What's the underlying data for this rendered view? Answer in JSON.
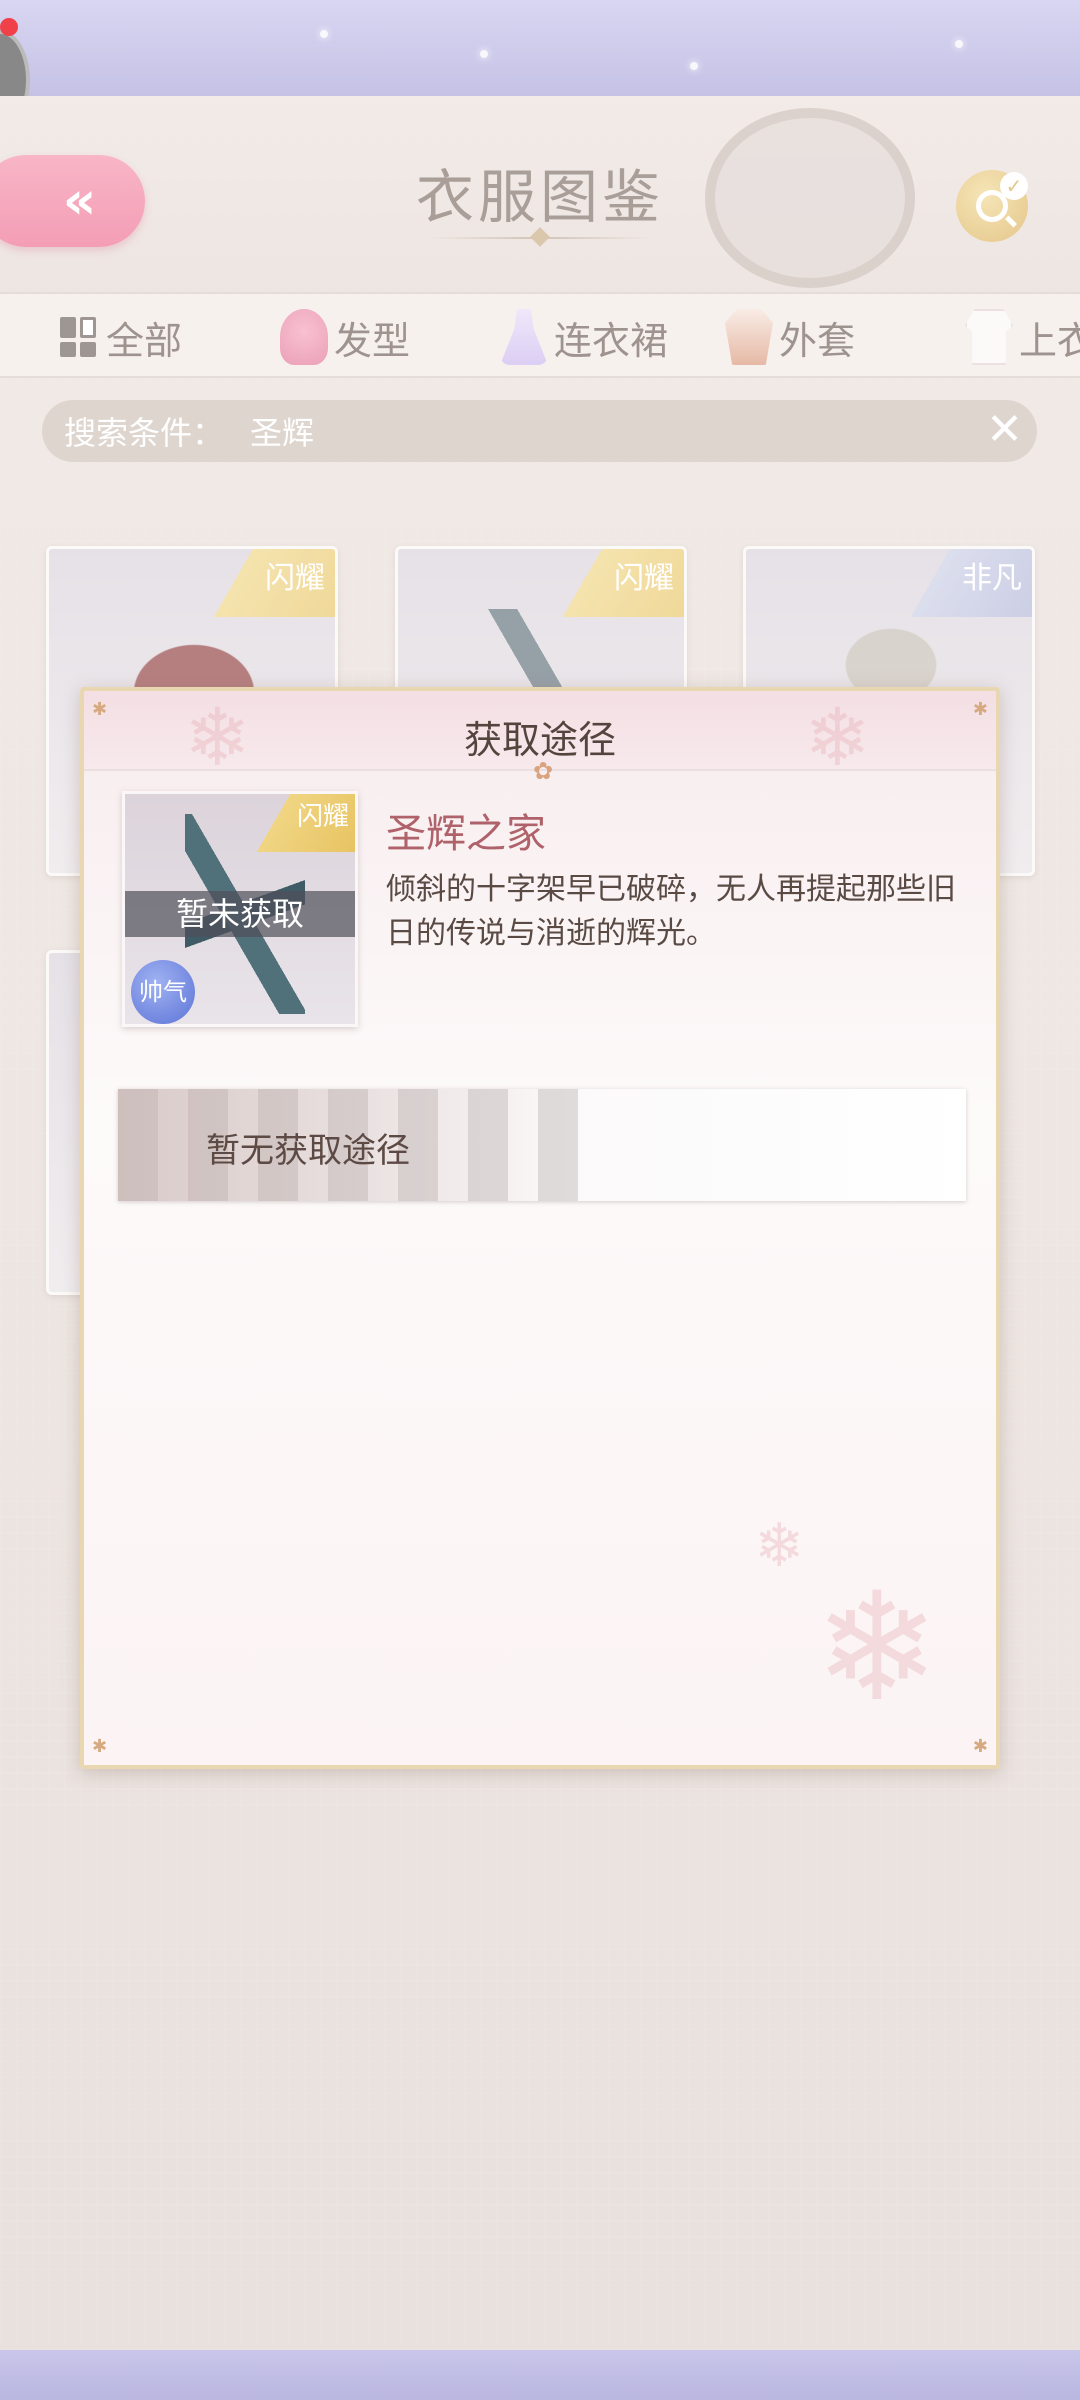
{
  "header": {
    "title": "衣服图鉴",
    "back_label": "«"
  },
  "tabs": [
    {
      "label": "全部",
      "icon": "grid-icon"
    },
    {
      "label": "发型",
      "icon": "hair-icon"
    },
    {
      "label": "连衣裙",
      "icon": "dress-icon"
    },
    {
      "label": "外套",
      "icon": "coat-icon"
    },
    {
      "label": "上衣",
      "icon": "top-icon"
    }
  ],
  "search": {
    "label": "搜索条件：",
    "value": "圣辉",
    "close": "✕"
  },
  "cards": [
    {
      "rarity": "闪耀"
    },
    {
      "rarity": "闪耀"
    },
    {
      "rarity": "非凡"
    }
  ],
  "modal": {
    "title": "获取途径",
    "item": {
      "rarity": "闪耀",
      "status": "暂未获取",
      "attribute": "帅气",
      "name": "圣辉之家",
      "description": "倾斜的十字架早已破碎，无人再提起那些旧日的传说与消逝的辉光。"
    },
    "source_text": "暂无获取途径"
  },
  "colors": {
    "accent_pink": "#ee6a8f",
    "gold": "#d6a94c",
    "name_red": "#b0626a"
  }
}
